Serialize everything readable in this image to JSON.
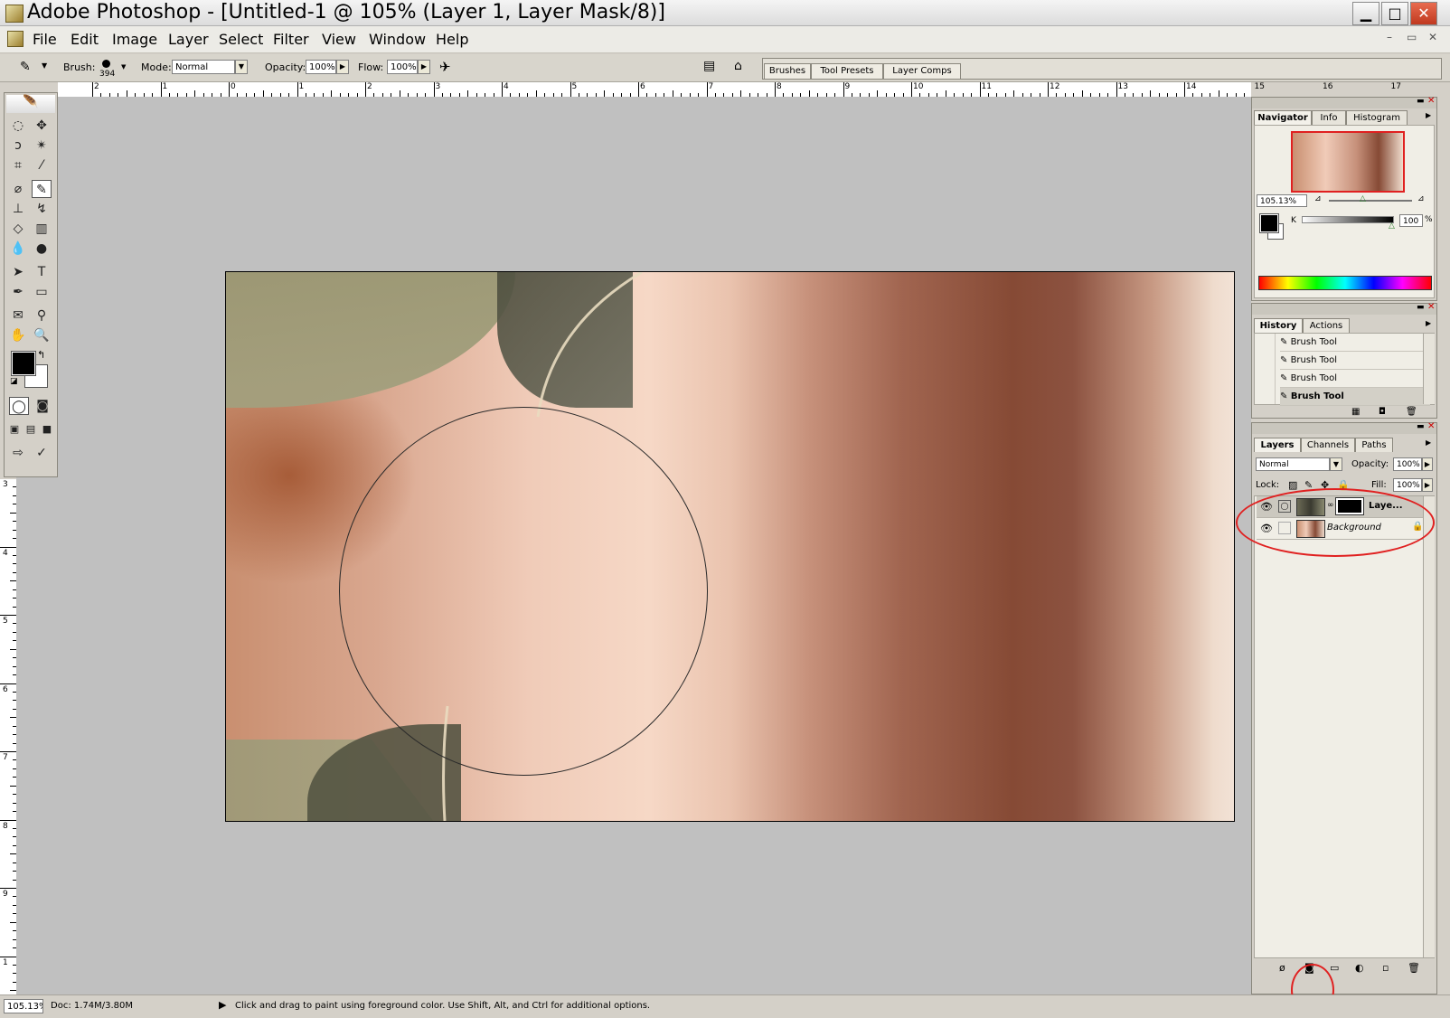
{
  "window": {
    "title": "Adobe Photoshop - [Untitled-1 @ 105% (Layer 1, Layer Mask/8)]",
    "minimize_glyph": "▁",
    "maximize_glyph": "□",
    "close_glyph": "✕"
  },
  "menu": [
    "File",
    "Edit",
    "Image",
    "Layer",
    "Select",
    "Filter",
    "View",
    "Window",
    "Help"
  ],
  "mdi_controls": [
    "–",
    "▭",
    "✕"
  ],
  "options": {
    "brush_label": "Brush:",
    "brush_size": "394",
    "mode_label": "Mode:",
    "mode_value": "Normal",
    "opacity_label": "Opacity:",
    "opacity_value": "100%",
    "flow_label": "Flow:",
    "flow_value": "100%"
  },
  "palette_well_tabs": [
    "Brushes",
    "Tool Presets",
    "Layer Comps"
  ],
  "ruler_h": [
    "2",
    "1",
    "0",
    "1",
    "2",
    "3",
    "4",
    "5",
    "6",
    "7",
    "8",
    "9",
    "10",
    "11",
    "12",
    "13",
    "14",
    "15",
    "16",
    "17"
  ],
  "ruler_v": [
    "3",
    "4",
    "5",
    "6",
    "7",
    "8",
    "9",
    "1"
  ],
  "navigator": {
    "tabs": [
      "Navigator",
      "Info",
      "Histogram"
    ],
    "zoom": "105.13%"
  },
  "color": {
    "channel_label": "K",
    "value": "100",
    "unit": "%"
  },
  "history": {
    "tabs": [
      "History",
      "Actions"
    ],
    "items": [
      "Brush Tool",
      "Brush Tool",
      "Brush Tool",
      "Brush Tool"
    ]
  },
  "layers": {
    "tabs": [
      "Layers",
      "Channels",
      "Paths"
    ],
    "blend_mode": "Normal",
    "opacity_label": "Opacity:",
    "opacity_value": "100%",
    "lock_label": "Lock:",
    "fill_label": "Fill:",
    "fill_value": "100%",
    "items": [
      {
        "name": "Laye...",
        "selected": true
      },
      {
        "name": "Background",
        "selected": false
      }
    ]
  },
  "status": {
    "zoom": "105.13%",
    "doc": "Doc: 1.74M/3.80M",
    "hint": "Click and drag to paint using foreground color.  Use Shift, Alt, and Ctrl for additional options."
  },
  "colors": {
    "annotation_red": "#e02020",
    "workspace": "#c0c0c0"
  }
}
